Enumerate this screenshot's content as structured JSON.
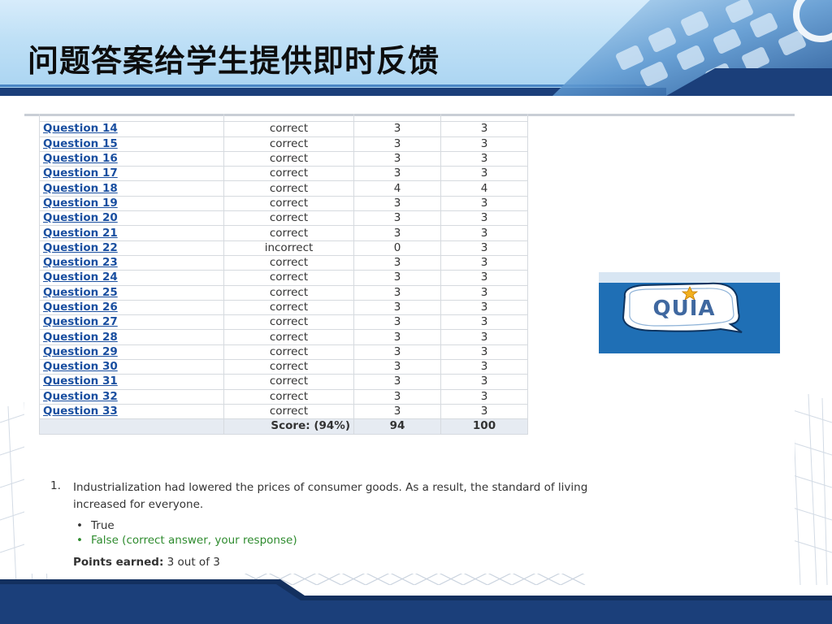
{
  "slide": {
    "title": "问题答案给学生提供即时反馈"
  },
  "results": {
    "rows": [
      {
        "question": "Question 14",
        "result": "correct",
        "points": "3",
        "max": "3"
      },
      {
        "question": "Question 15",
        "result": "correct",
        "points": "3",
        "max": "3"
      },
      {
        "question": "Question 16",
        "result": "correct",
        "points": "3",
        "max": "3"
      },
      {
        "question": "Question 17",
        "result": "correct",
        "points": "3",
        "max": "3"
      },
      {
        "question": "Question 18",
        "result": "correct",
        "points": "4",
        "max": "4"
      },
      {
        "question": "Question 19",
        "result": "correct",
        "points": "3",
        "max": "3"
      },
      {
        "question": "Question 20",
        "result": "correct",
        "points": "3",
        "max": "3"
      },
      {
        "question": "Question 21",
        "result": "correct",
        "points": "3",
        "max": "3"
      },
      {
        "question": "Question 22",
        "result": "incorrect",
        "points": "0",
        "max": "3"
      },
      {
        "question": "Question 23",
        "result": "correct",
        "points": "3",
        "max": "3"
      },
      {
        "question": "Question 24",
        "result": "correct",
        "points": "3",
        "max": "3"
      },
      {
        "question": "Question 25",
        "result": "correct",
        "points": "3",
        "max": "3"
      },
      {
        "question": "Question 26",
        "result": "correct",
        "points": "3",
        "max": "3"
      },
      {
        "question": "Question 27",
        "result": "correct",
        "points": "3",
        "max": "3"
      },
      {
        "question": "Question 28",
        "result": "correct",
        "points": "3",
        "max": "3"
      },
      {
        "question": "Question 29",
        "result": "correct",
        "points": "3",
        "max": "3"
      },
      {
        "question": "Question 30",
        "result": "correct",
        "points": "3",
        "max": "3"
      },
      {
        "question": "Question 31",
        "result": "correct",
        "points": "3",
        "max": "3"
      },
      {
        "question": "Question 32",
        "result": "correct",
        "points": "3",
        "max": "3"
      },
      {
        "question": "Question 33",
        "result": "correct",
        "points": "3",
        "max": "3"
      }
    ],
    "score_label": "Score: (94%)",
    "score_points": "94",
    "score_max": "100"
  },
  "question_detail": {
    "number": "1.",
    "text": "Industrialization had lowered the prices of consumer goods. As a result, the standard of living increased for everyone.",
    "answers": [
      {
        "label": "True",
        "is_correct": false
      },
      {
        "label": "False (correct answer, your response)",
        "is_correct": true
      }
    ],
    "points_label": "Points earned:",
    "points_value": "3 out of 3"
  },
  "logo": {
    "text": "QUIA"
  },
  "colors": {
    "header_navy": "#1b3f7a",
    "link_blue": "#1a4fa0",
    "correct_green": "#2e8b2e",
    "quia_blue": "#1f6fb5",
    "score_row_bg": "#e6ebf2"
  },
  "icons": {
    "header_decoration": "keyboard-image",
    "bullet": "bullet-dot"
  }
}
